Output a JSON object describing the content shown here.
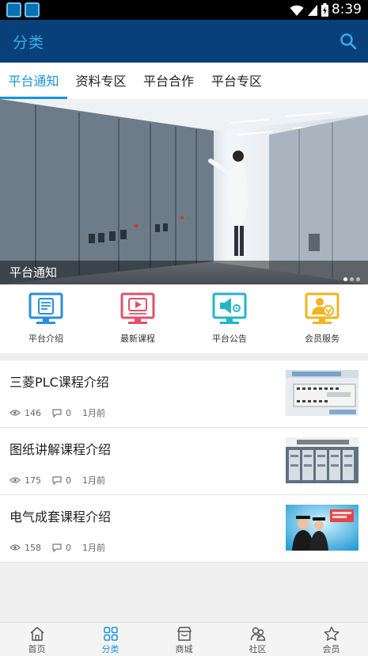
{
  "status_bar": {
    "time": "8:39"
  },
  "app_bar": {
    "title": "分类"
  },
  "tabs": [
    {
      "label": "平台通知"
    },
    {
      "label": "资料专区"
    },
    {
      "label": "平台合作"
    },
    {
      "label": "平台专区"
    }
  ],
  "active_tab": "平台通知",
  "banner": {
    "caption": "平台通知",
    "slide_count": 3,
    "current_slide": 1
  },
  "quick_links": [
    {
      "label": "平台介绍",
      "icon": "document-monitor-icon",
      "color": "#2a8fd8"
    },
    {
      "label": "最新课程",
      "icon": "video-monitor-icon",
      "color": "#e0516b"
    },
    {
      "label": "平台公告",
      "icon": "megaphone-monitor-icon",
      "color": "#24b5c6"
    },
    {
      "label": "会员服务",
      "icon": "vip-user-monitor-icon",
      "color": "#f2b41e"
    }
  ],
  "articles": [
    {
      "title": "三菱PLC课程介绍",
      "views": "146",
      "comments": "0",
      "time": "1月前"
    },
    {
      "title": "图纸讲解课程介绍",
      "views": "175",
      "comments": "0",
      "time": "1月前"
    },
    {
      "title": "电气成套课程介绍",
      "views": "158",
      "comments": "0",
      "time": "1月前"
    }
  ],
  "bottom_nav": [
    {
      "label": "首页",
      "icon": "home-icon"
    },
    {
      "label": "分类",
      "icon": "grid-icon"
    },
    {
      "label": "商城",
      "icon": "store-icon"
    },
    {
      "label": "社区",
      "icon": "community-icon"
    },
    {
      "label": "会员",
      "icon": "star-icon"
    }
  ],
  "active_nav": "分类",
  "colors": {
    "app_bar": "#08407a",
    "accent": "#1a93d9",
    "title": "#37aef0"
  }
}
